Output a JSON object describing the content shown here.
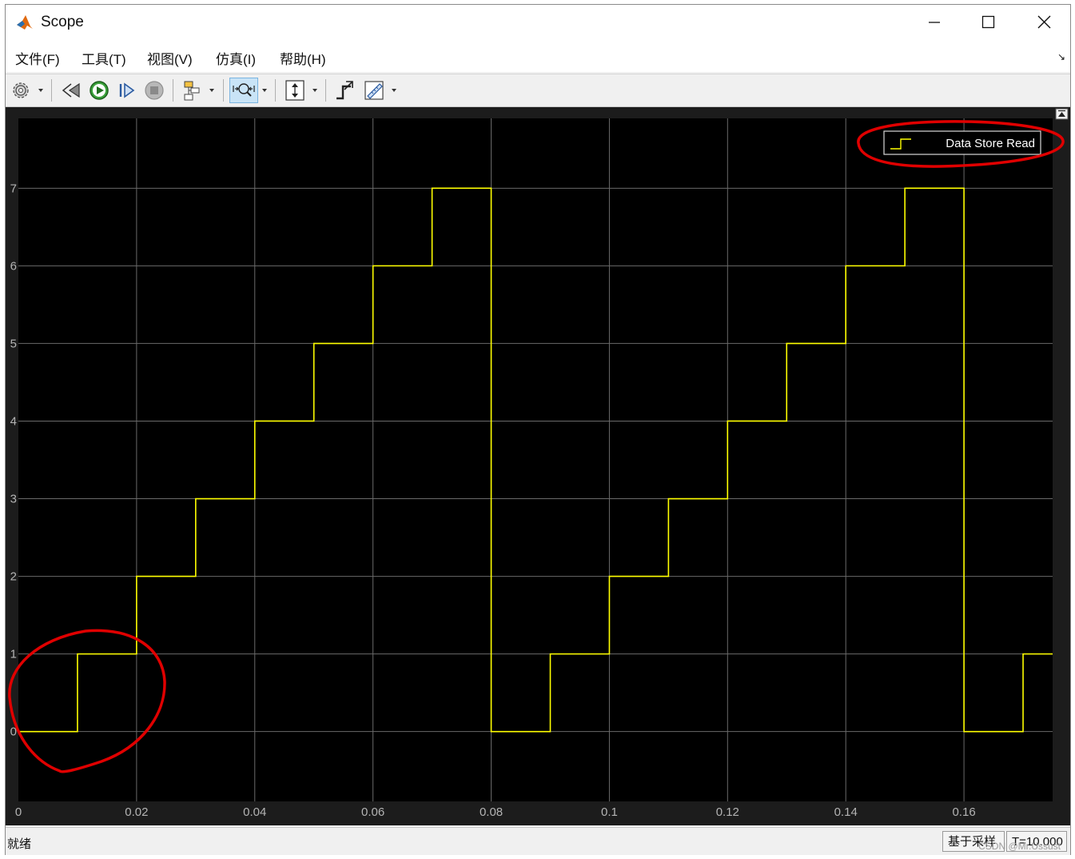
{
  "window": {
    "title": "Scope"
  },
  "menu": {
    "items": [
      {
        "label": "文件(F)"
      },
      {
        "label": "工具(T)"
      },
      {
        "label": "视图(V)"
      },
      {
        "label": "仿真(I)"
      },
      {
        "label": "帮助(H)"
      }
    ]
  },
  "icons": {
    "app": "matlab-icon",
    "minimize": "minimize-icon",
    "maximize": "maximize-icon",
    "close": "close-icon",
    "toolbar": [
      "settings-gear-icon",
      "step-back-icon",
      "run-icon",
      "step-forward-icon",
      "stop-icon",
      "highlight-block-icon",
      "zoom-icon",
      "scale-axes-icon",
      "triggers-icon",
      "measurements-icon"
    ]
  },
  "colors": {
    "plot_background": "#000000",
    "axes_panel": "#1c1c1c",
    "grid": "#6a6a6a",
    "signal": "#ffff00",
    "annotation": "#e00000"
  },
  "chart_data": {
    "type": "line",
    "step": true,
    "x": [
      0,
      0.01,
      0.02,
      0.03,
      0.04,
      0.05,
      0.06,
      0.07,
      0.08,
      0.09,
      0.1,
      0.11,
      0.12,
      0.13,
      0.14,
      0.15,
      0.16,
      0.17
    ],
    "series": [
      {
        "name": "Data Store Read",
        "values": [
          0,
          1,
          2,
          3,
          4,
          5,
          6,
          7,
          0,
          1,
          2,
          3,
          4,
          5,
          6,
          7,
          0,
          1
        ]
      }
    ],
    "xlim": [
      0,
      0.175
    ],
    "ylim": [
      -0.9,
      7.9
    ],
    "xticks": [
      0,
      0.02,
      0.04,
      0.06,
      0.08,
      0.1,
      0.12,
      0.14,
      0.16
    ],
    "xtick_labels": [
      "0",
      "0.02",
      "0.04",
      "0.06",
      "0.08",
      "0.1",
      "0.12",
      "0.14",
      "0.16"
    ],
    "yticks": [
      0,
      1,
      2,
      3,
      4,
      5,
      6,
      7
    ],
    "ytick_labels": [
      "0",
      "1",
      "2",
      "3",
      "4",
      "5",
      "6",
      "7"
    ],
    "grid": true,
    "legend": "top-right"
  },
  "status": {
    "text": "就绪",
    "sample_mode": "基于采样",
    "time": "T=10.000",
    "watermark": "CSDN @Mr.Ussust"
  }
}
